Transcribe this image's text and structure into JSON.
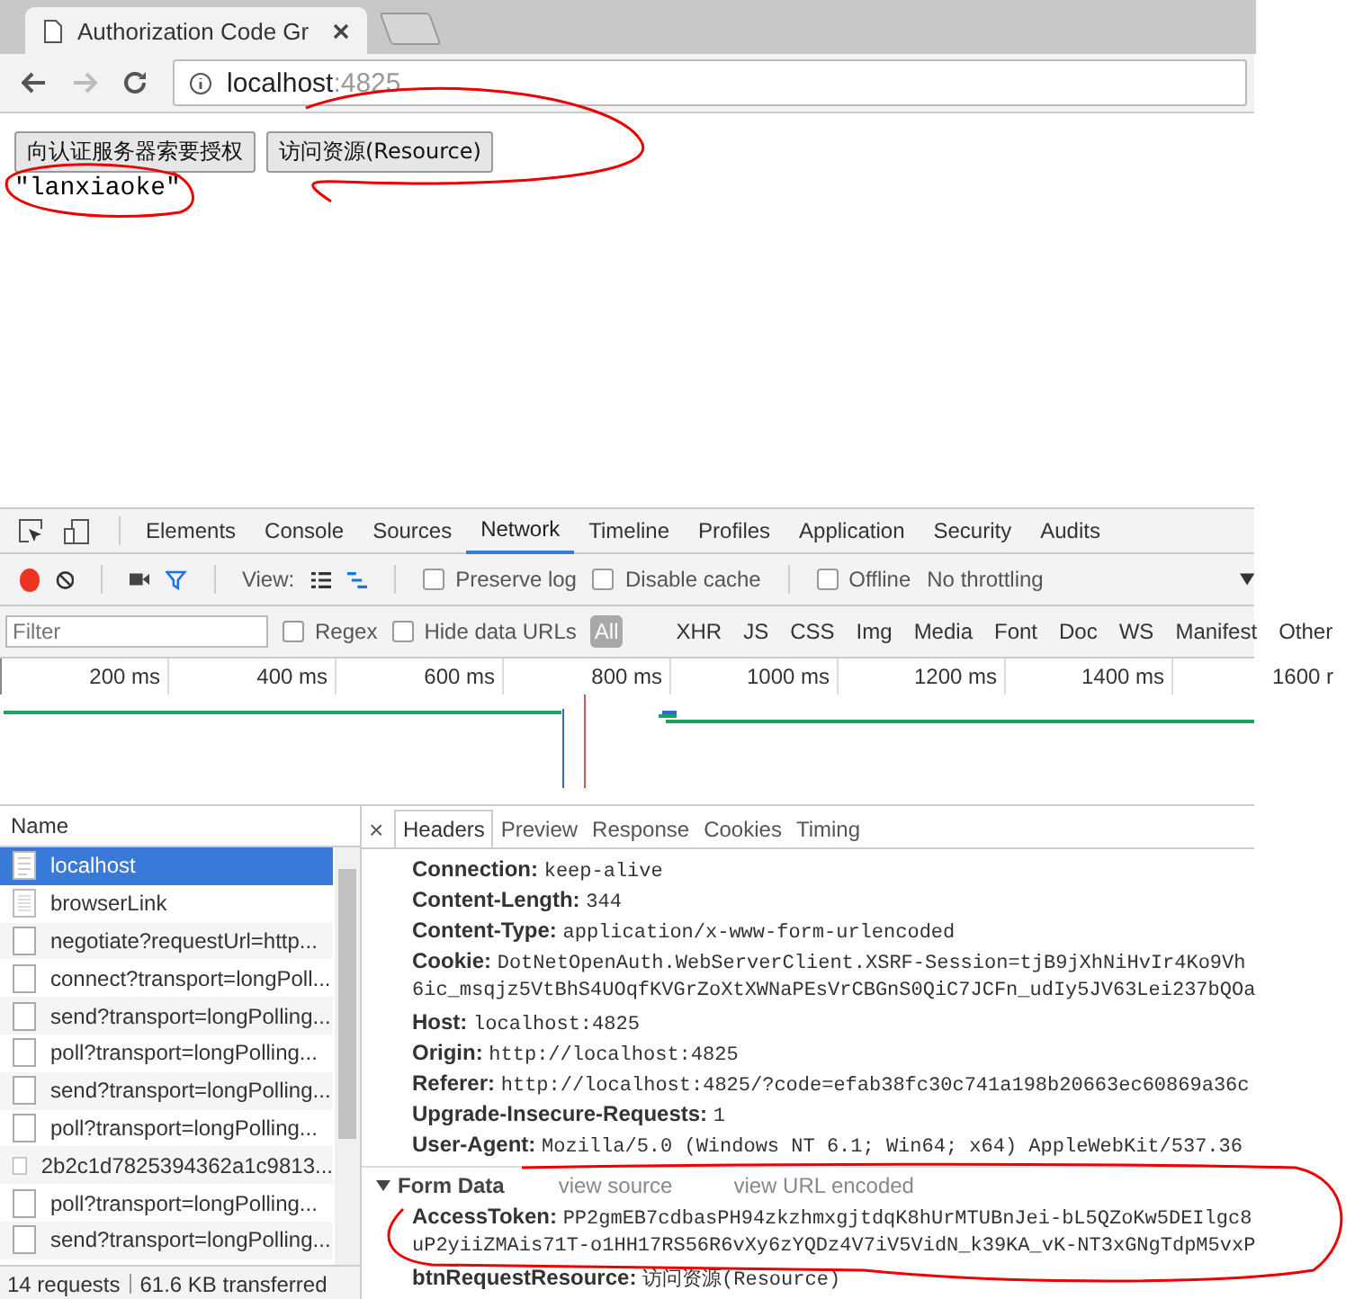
{
  "browser": {
    "tab_title": "Authorization Code Gr",
    "address_host": "localhost",
    "address_port": ":4825"
  },
  "page": {
    "buttons": [
      "向认证服务器索要授权",
      "访问资源(Resource)"
    ],
    "output": "\"lanxiaoke\""
  },
  "devtools": {
    "panel_tabs": [
      {
        "label": "Elements",
        "selected": false
      },
      {
        "label": "Console",
        "selected": false
      },
      {
        "label": "Sources",
        "selected": false
      },
      {
        "label": "Network",
        "selected": true
      },
      {
        "label": "Timeline",
        "selected": false
      },
      {
        "label": "Profiles",
        "selected": false
      },
      {
        "label": "Application",
        "selected": false
      },
      {
        "label": "Security",
        "selected": false
      },
      {
        "label": "Audits",
        "selected": false
      }
    ],
    "recording": true,
    "view_label": "View:",
    "toolbar_options": [
      {
        "label": "Preserve log",
        "checked": false
      },
      {
        "label": "Disable cache",
        "checked": false
      },
      {
        "label": "Offline",
        "checked": false
      }
    ],
    "throttling": "No throttling",
    "filter": {
      "placeholder": "Filter",
      "options": [
        {
          "label": "Regex",
          "checked": false
        },
        {
          "label": "Hide data URLs",
          "checked": false
        }
      ],
      "types": [
        {
          "label": "All",
          "selected": true
        },
        {
          "label": "XHR",
          "selected": false
        },
        {
          "label": "JS",
          "selected": false
        },
        {
          "label": "CSS",
          "selected": false
        },
        {
          "label": "Img",
          "selected": false
        },
        {
          "label": "Media",
          "selected": false
        },
        {
          "label": "Font",
          "selected": false
        },
        {
          "label": "Doc",
          "selected": false
        },
        {
          "label": "WS",
          "selected": false
        },
        {
          "label": "Manifest",
          "selected": false
        },
        {
          "label": "Other",
          "selected": false
        }
      ]
    },
    "timeline_ticks": [
      "200 ms",
      "400 ms",
      "600 ms",
      "800 ms",
      "1000 ms",
      "1200 ms",
      "1400 ms",
      "1600 r"
    ],
    "name_column": "Name",
    "requests": [
      {
        "name": "localhost",
        "kind": "document",
        "selected": true
      },
      {
        "name": "browserLink",
        "kind": "script",
        "selected": false
      },
      {
        "name": "negotiate?requestUrl=http...",
        "kind": "other",
        "selected": false
      },
      {
        "name": "connect?transport=longPoll...",
        "kind": "other",
        "selected": false
      },
      {
        "name": "send?transport=longPolling...",
        "kind": "other",
        "selected": false
      },
      {
        "name": "poll?transport=longPolling...",
        "kind": "other",
        "selected": false
      },
      {
        "name": "send?transport=longPolling...",
        "kind": "other",
        "selected": false
      },
      {
        "name": "poll?transport=longPolling...",
        "kind": "other",
        "selected": false
      },
      {
        "name": "2b2c1d7825394362a1c9813...",
        "kind": "other",
        "selected": false
      },
      {
        "name": "poll?transport=longPolling...",
        "kind": "other",
        "selected": false
      },
      {
        "name": "send?transport=longPolling...",
        "kind": "other",
        "selected": false
      }
    ],
    "status": [
      "14 requests",
      "61.6 KB transferred"
    ],
    "close_icon": "×",
    "detail_tabs": [
      {
        "label": "Headers",
        "selected": true
      },
      {
        "label": "Preview",
        "selected": false
      },
      {
        "label": "Response",
        "selected": false
      },
      {
        "label": "Cookies",
        "selected": false
      },
      {
        "label": "Timing",
        "selected": false
      }
    ],
    "headers": [
      {
        "name": "Connection:",
        "value": "keep-alive"
      },
      {
        "name": "Content-Length:",
        "value": "344"
      },
      {
        "name": "Content-Type:",
        "value": "application/x-www-form-urlencoded"
      },
      {
        "name": "Cookie:",
        "value": "DotNetOpenAuth.WebServerClient.XSRF-Session=tjB9jXhNiHvIr4Ko9Vh",
        "continuation": "6ic_msqjz5VtBhS4UOqfKVGrZoXtXWNaPEsVrCBGnS0QiC7JCFn_udIy5JV63Lei237bQOa"
      },
      {
        "name": "Host:",
        "value": "localhost:4825"
      },
      {
        "name": "Origin:",
        "value": "http://localhost:4825"
      },
      {
        "name": "Referer:",
        "value": "http://localhost:4825/?code=efab38fc30c741a198b20663ec60869a36c"
      },
      {
        "name": "Upgrade-Insecure-Requests:",
        "value": "1"
      },
      {
        "name": "User-Agent:",
        "value": "Mozilla/5.0 (Windows NT 6.1; Win64; x64) AppleWebKit/537.36"
      }
    ],
    "form_data": {
      "title": "Form Data",
      "expanded": true,
      "links": [
        "view source",
        "view URL encoded"
      ],
      "fields": [
        {
          "name": "AccessToken:",
          "value": "PP2gmEB7cdbasPH94zkzhmxgjtdqK8hUrMTUBnJei-bL5QZoKw5DEIlgc8",
          "continuation": "uP2yiiZMAis71T-o1HH17RS56R6vXy6zYQDz4V7iV5VidN_k39KA_vK-NT3xGNgTdpM5vxP"
        },
        {
          "name": "btnRequestResource:",
          "value": "访问资源(Resource)"
        }
      ]
    }
  }
}
